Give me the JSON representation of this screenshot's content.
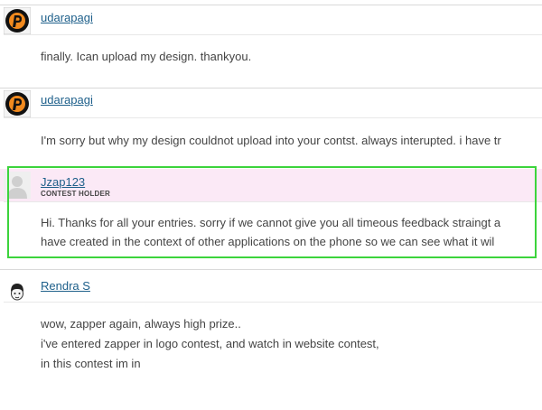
{
  "comments": [
    {
      "username": "udarapagi",
      "text_lines": [
        "finally. Ican upload my design. thankyou."
      ]
    },
    {
      "username": "udarapagi",
      "text_lines": [
        "I'm sorry but why my design couldnot upload into your contst. always interupted. i have tr"
      ]
    },
    {
      "username": "Jzap123",
      "role": "CONTEST HOLDER",
      "text_lines": [
        "Hi. Thanks for all your entries. sorry if we cannot give you all timeous feedback straingt a",
        "have created in the context of other applications on the phone so we can see what it wil"
      ]
    },
    {
      "username": "Rendra S",
      "text_lines": [
        "wow, zapper again, always high prize..",
        "i've entered zapper in logo contest, and watch in website contest,",
        "in this contest im in"
      ]
    }
  ],
  "colors": {
    "link": "#1d5f8a",
    "holder_background": "#fbe9f6",
    "highlight_border": "#3cd43c"
  }
}
